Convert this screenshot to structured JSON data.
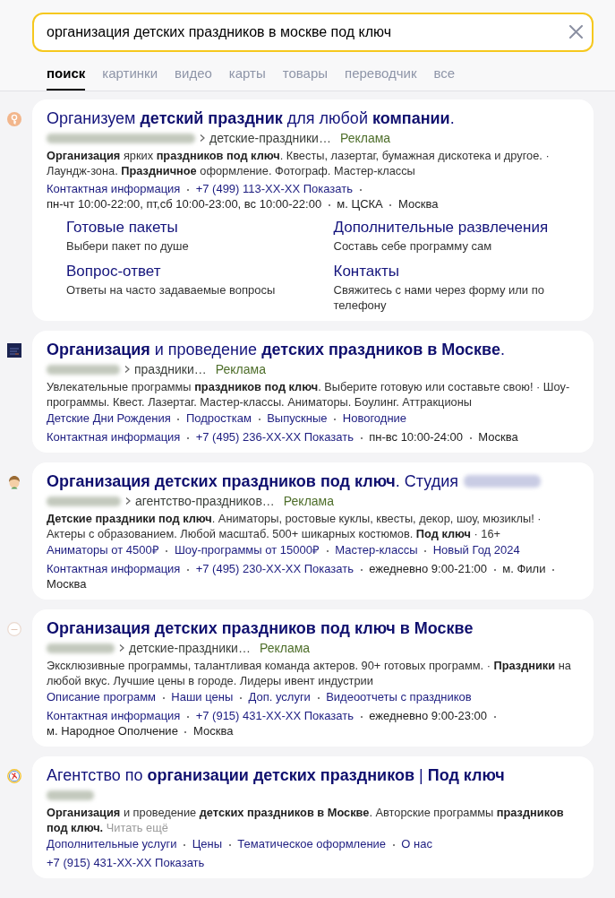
{
  "search": {
    "value": "организация детских праздников в москве под ключ"
  },
  "tabs": [
    {
      "label": "поиск",
      "selected": true
    },
    {
      "label": "картинки",
      "selected": false
    },
    {
      "label": "видео",
      "selected": false
    },
    {
      "label": "карты",
      "selected": false
    },
    {
      "label": "товары",
      "selected": false
    },
    {
      "label": "переводчик",
      "selected": false
    },
    {
      "label": "все",
      "selected": false
    }
  ],
  "results": [
    {
      "title": "Организуем **детский праздник** для любой **компании**.",
      "domain_blurred": true,
      "path": "детские-праздники…",
      "label": "Реклама",
      "snippet": "**Организация** ярких **праздников под ключ**. Квесты, лазертаг, бумажная дискотека и другое. · Лаундж-зона. **Праздничное** оформление. Фотограф. Мастер-классы",
      "contacts": [
        {
          "kind": "link",
          "text": "Контактная информация"
        },
        {
          "kind": "phone",
          "text": "+7 (499) 113-XX-XX",
          "action": "Показать"
        },
        {
          "kind": "info",
          "text": "пн-чт 10:00-22:00, пт,сб 10:00-23:00, вс 10:00-22:00"
        },
        {
          "kind": "info",
          "text": "м. ЦСКА"
        },
        {
          "kind": "info",
          "text": "Москва"
        }
      ],
      "sitelink_cards": [
        {
          "title": "Готовые пакеты",
          "description": "Выбери пакет по душе"
        },
        {
          "title": "Дополнительные развлечения",
          "description": "Составь себе программу сам"
        },
        {
          "title": "Вопрос-ответ",
          "description": "Ответы на часто задаваемые вопросы"
        },
        {
          "title": "Контакты",
          "description": "Свяжитесь с нами через форму или по телефону"
        }
      ]
    },
    {
      "title": "**Организация** и проведение **детских праздников в Москве**.",
      "domain_blurred": true,
      "path": "праздники…",
      "label": "Реклама",
      "snippet": "Увлекательные программы **праздников под ключ**. Выберите готовую или составьте свою! · Шоу-программы. Квест. Лазертаг. Мастер-классы. Аниматоры. Боулинг. Аттракционы",
      "sitelinks": [
        "Детские Дни Рождения",
        "Подросткам",
        "Выпускные",
        "Новогодние"
      ],
      "contacts": [
        {
          "kind": "link",
          "text": "Контактная информация"
        },
        {
          "kind": "phone",
          "text": "+7 (495) 236-XX-XX",
          "action": "Показать"
        },
        {
          "kind": "info",
          "text": "пн-вс 10:00-24:00"
        },
        {
          "kind": "info",
          "text": "Москва"
        }
      ]
    },
    {
      "title": "**Организация детских праздников под ключ**. Студия",
      "title_blurred": true,
      "domain_blurred": true,
      "path": "агентство-праздников…",
      "label": "Реклама",
      "snippet": "**Детские праздники под ключ**. Аниматоры, ростовые куклы, квесты, декор, шоу, мюзиклы! · Актеры с образованием. Любой масштаб. 500+ шикарных костюмов. **Под ключ** · 16+",
      "sitelinks": [
        "Аниматоры от 4500₽",
        "Шоу-программы от 15000₽",
        "Мастер-классы",
        "Новый Год 2024"
      ],
      "contacts": [
        {
          "kind": "link",
          "text": "Контактная информация"
        },
        {
          "kind": "phone",
          "text": "+7 (495) 230-XX-XX",
          "action": "Показать"
        },
        {
          "kind": "info",
          "text": "ежедневно 9:00-21:00"
        },
        {
          "kind": "info",
          "text": "м. Фили"
        },
        {
          "kind": "info",
          "text": "Москва"
        }
      ]
    },
    {
      "title": "Организация детских праздников под ключ в Москве",
      "title_bold": true,
      "domain_blurred": true,
      "path": "детские-праздники…",
      "label": "Реклама",
      "snippet": "Эксклюзивные программы, талантливая команда актеров. 90+ готовых программ. · **Праздники** на любой вкус. Лучшие цены в городе. Лидеры ивент индустрии",
      "sitelinks": [
        "Описание программ",
        "Наши цены",
        "Доп. услуги",
        "Видеоотчеты с праздников"
      ],
      "contacts": [
        {
          "kind": "link",
          "text": "Контактная информация"
        },
        {
          "kind": "phone",
          "text": "+7 (915) 431-XX-XX",
          "action": "Показать"
        },
        {
          "kind": "info",
          "text": "ежедневно 9:00-23:00"
        },
        {
          "kind": "info",
          "text": "м. Народное Ополчение"
        },
        {
          "kind": "info",
          "text": "Москва"
        }
      ]
    },
    {
      "title": "Агентство по **организации детских праздников** | **Под ключ**",
      "domain_blurred": true,
      "snippet": "**Организация** и проведение **детских праздников в Москве**. Авторские программы **праздников под ключ.**",
      "more": "Читать ещё",
      "sitelinks": [
        "Дополнительные услуги",
        "Цены",
        "Тематическое оформление",
        "О нас"
      ],
      "contacts": [
        {
          "kind": "phone",
          "text": "+7 (915) 431-XX-XX",
          "action": "Показать"
        }
      ]
    }
  ]
}
